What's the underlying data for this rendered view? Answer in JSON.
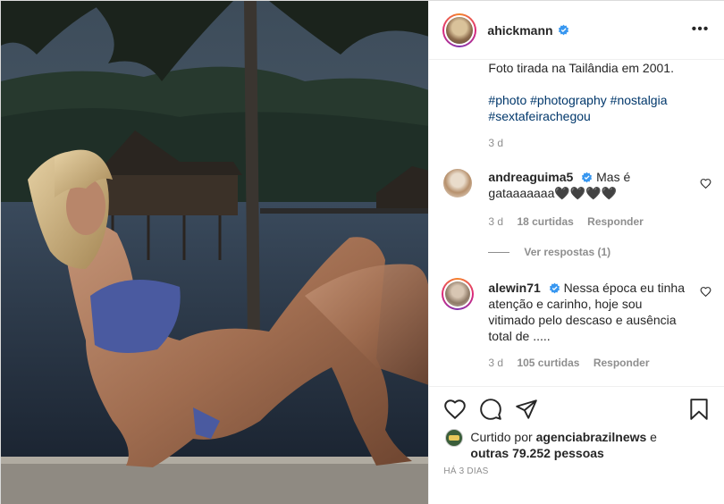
{
  "post": {
    "username": "ahickmann",
    "verified": true,
    "more_options": "•••"
  },
  "caption": {
    "line1": "Foto tirada na Tailândia em 2001.",
    "hashtags": [
      "#photo",
      "#photography",
      "#nostalgia",
      "#sextafeirachegou"
    ],
    "time": "3 d"
  },
  "comments": [
    {
      "username": "andreaguima5",
      "verified": true,
      "text": "Mas é gataaaaaaa🖤🖤🖤🖤",
      "time": "3 d",
      "likes": "18 curtidas",
      "reply_label": "Responder",
      "view_replies": "Ver respostas (1)"
    },
    {
      "username": "alewin71",
      "verified": true,
      "text": "Nessa época eu tinha atenção e carinho, hoje sou vitimado pelo descaso e ausência total de .....",
      "time": "3 d",
      "likes": "105 curtidas",
      "reply_label": "Responder"
    }
  ],
  "actions": {
    "icons": [
      "heart-icon",
      "comment-icon",
      "share-icon",
      "bookmark-icon"
    ]
  },
  "likes": {
    "prefix": "Curtido por",
    "liker": "agenciabrazilnews",
    "connector": "e",
    "others": "outras 79.252 pessoas"
  },
  "date": "HÁ 3 DIAS",
  "colors": {
    "verified_blue": "#3897f0",
    "text": "#262626",
    "muted": "#8e8e8e",
    "hashtag": "#00376b",
    "border": "#efefef"
  }
}
